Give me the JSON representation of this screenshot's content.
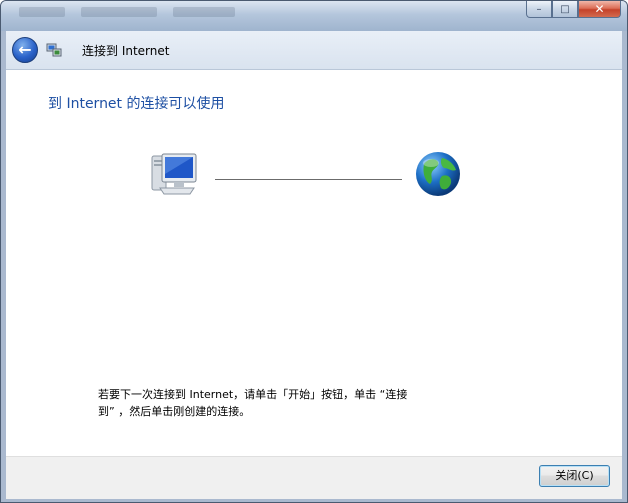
{
  "window": {
    "controls": {
      "minimize": "–",
      "maximize": "□",
      "close": "✕"
    }
  },
  "nav": {
    "back_icon": "back-arrow-icon",
    "app_icon": "network-icon",
    "title": "连接到 Internet"
  },
  "main": {
    "heading": "到 Internet 的连接可以使用",
    "icons": [
      "computer-icon",
      "globe-icon"
    ],
    "info_line1": "若要下一次连接到 Internet，请单击「开始」按钮，单击 “连接",
    "info_line2": "到” ，然后单击刚创建的连接。"
  },
  "footer": {
    "close_label": "关闭(C)"
  },
  "colors": {
    "heading": "#1d4fa3",
    "frame": "#aab9cf"
  }
}
